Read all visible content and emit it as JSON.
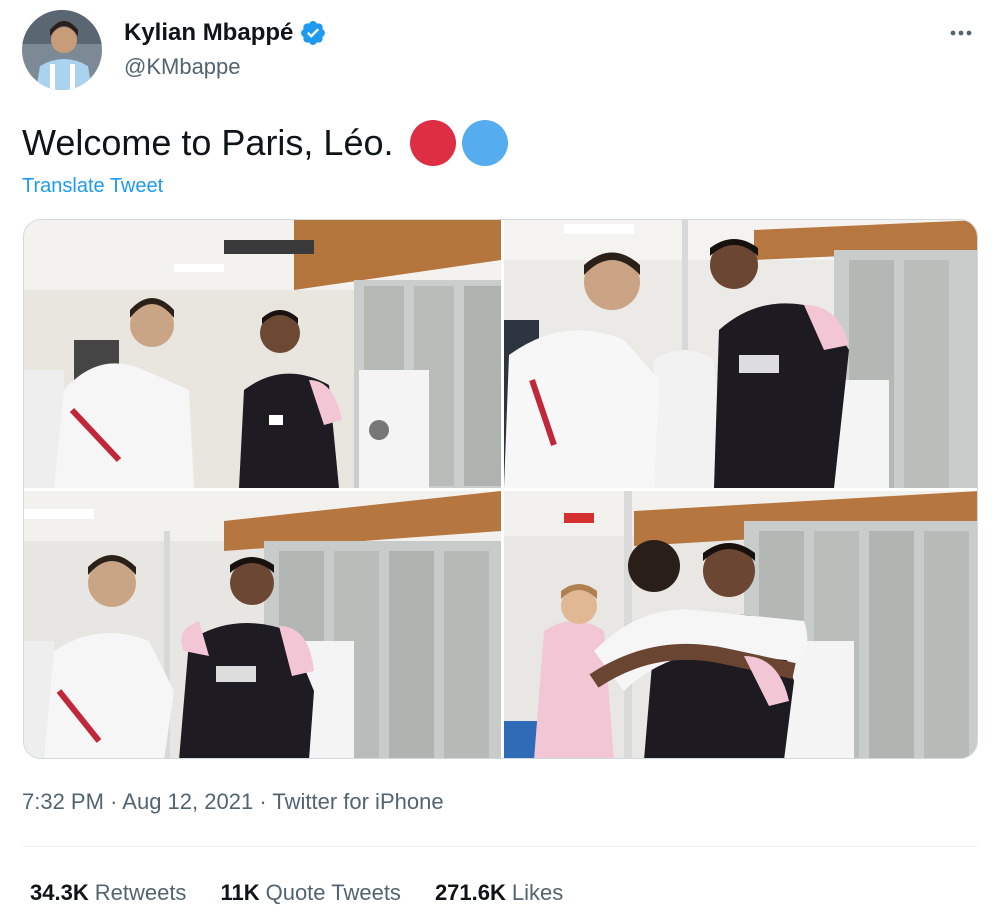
{
  "author": {
    "display_name": "Kylian Mbappé",
    "handle": "@KMbappe",
    "verified": true,
    "avatar_icon": "profile-photo"
  },
  "tweet": {
    "text": "Welcome to Paris, Léo.",
    "emoji": [
      "red-circle",
      "blue-circle"
    ],
    "translate_label": "Translate Tweet"
  },
  "media": {
    "count": 4,
    "items": [
      "photo-1",
      "photo-2",
      "photo-3",
      "photo-4"
    ]
  },
  "meta": {
    "time": "7:32 PM",
    "separator": "·",
    "date": "Aug 12, 2021",
    "source": "Twitter for iPhone"
  },
  "stats": {
    "retweets_count": "34.3K",
    "retweets_label": "Retweets",
    "quotes_count": "11K",
    "quotes_label": "Quote Tweets",
    "likes_count": "271.6K",
    "likes_label": "Likes"
  },
  "colors": {
    "accent": "#1d9bf0",
    "text": "#0f1419",
    "secondary_text": "#536471",
    "emoji_red": "#dd2e44",
    "emoji_blue": "#55acee"
  }
}
